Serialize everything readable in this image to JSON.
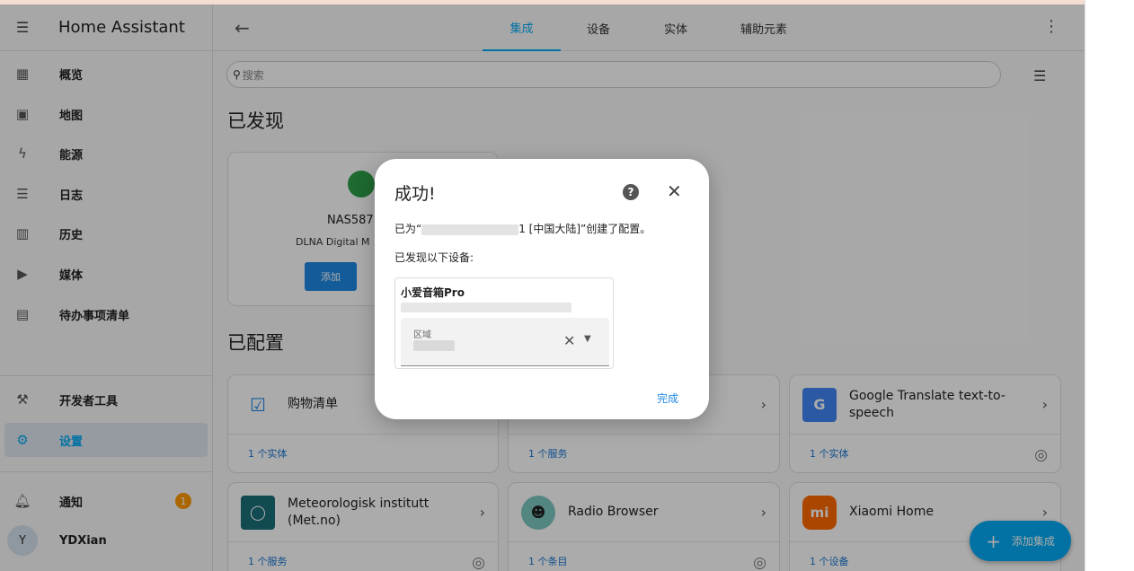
{
  "app": {
    "title": "Home Assistant"
  },
  "sidebar": {
    "items": [
      {
        "label": "概览",
        "icon": "dashboard-icon"
      },
      {
        "label": "地图",
        "icon": "map-icon"
      },
      {
        "label": "能源",
        "icon": "energy-icon"
      },
      {
        "label": "日志",
        "icon": "logbook-icon"
      },
      {
        "label": "历史",
        "icon": "history-icon"
      },
      {
        "label": "媒体",
        "icon": "media-icon"
      },
      {
        "label": "待办事项清单",
        "icon": "todo-icon"
      }
    ],
    "dev_tools": "开发者工具",
    "settings": "设置",
    "notifications": "通知",
    "notification_count": "1",
    "user_initial": "Y",
    "user_name": "YDXian"
  },
  "header": {
    "tabs": [
      "集成",
      "设备",
      "实体",
      "辅助元素"
    ],
    "active_tab": "集成"
  },
  "search": {
    "placeholder": "搜索"
  },
  "discovered": {
    "title": "已发现",
    "card": {
      "name": "NAS587",
      "subtitle": "DLNA Digital M",
      "add_label": "添加"
    }
  },
  "configured": {
    "title": "已配置",
    "cards": [
      {
        "name": "购物清单",
        "foot": "1 个实体"
      },
      {
        "name": "",
        "foot": "1 个服务"
      },
      {
        "name": "Google Translate text-to-speech",
        "foot": "1 个实体"
      },
      {
        "name": "Meteorologisk institutt (Met.no)",
        "foot": "1 个服务"
      },
      {
        "name": "Radio Browser",
        "foot": "1 个条目"
      },
      {
        "name": "Xiaomi Home",
        "foot": "1 个设备"
      }
    ]
  },
  "fab": {
    "label": "添加集成"
  },
  "dialog": {
    "title": "成功!",
    "created_prefix": "已为“",
    "created_suffix": "1 [中国大陆]”创建了配置。",
    "found_devices": "已发现以下设备:",
    "device_name": "小爱音箱Pro",
    "area_label": "区域",
    "done_label": "完成"
  },
  "colors": {
    "accent": "#03a9f4",
    "primary_button": "#1e88e5",
    "badge": "#ff9800"
  }
}
